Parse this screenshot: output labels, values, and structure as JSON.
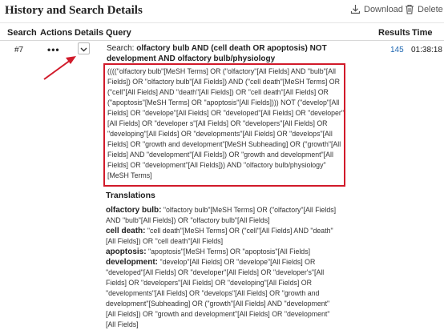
{
  "header": {
    "title": "History and Search Details",
    "download_label": "Download",
    "delete_label": "Delete"
  },
  "table": {
    "columns": [
      "Search",
      "Actions",
      "Details",
      "Query",
      "Results",
      "Time"
    ],
    "row": {
      "search_num": "#7",
      "actions_icon": "ellipsis-icon",
      "details_icon": "chevron-down-icon",
      "query_prefix": "Search:",
      "query_bold": "olfactory bulb AND (cell death OR apoptosis) NOT development AND olfactory bulb/physiology",
      "query_expanded": "((((\"olfactory bulb\"[MeSH Terms] OR (\"olfactory\"[All Fields] AND \"bulb\"[All Fields]) OR \"olfactory bulb\"[All Fields]) AND (\"cell death\"[MeSH Terms] OR (\"cell\"[All Fields] AND \"death\"[All Fields]) OR \"cell death\"[All Fields] OR (\"apoptosis\"[MeSH Terms] OR \"apoptosis\"[All Fields]))) NOT (\"develop\"[All Fields] OR \"develope\"[All Fields] OR \"developed\"[All Fields] OR \"developer\"[All Fields] OR \"developer s\"[All Fields] OR \"developers\"[All Fields] OR \"developing\"[All Fields] OR \"developments\"[All Fields] OR \"develops\"[All Fields] OR \"growth and development\"[MeSH Subheading] OR (\"growth\"[All Fields] AND \"development\"[All Fields]) OR \"growth and development\"[All Fields] OR \"development\"[All Fields])) AND \"olfactory bulb/physiology\"[MeSH Terms]",
      "results": "145",
      "time": "01:38:18"
    }
  },
  "translations": {
    "title": "Translations",
    "items": [
      {
        "term": "olfactory bulb:",
        "text": "\"olfactory bulb\"[MeSH Terms] OR (\"olfactory\"[All Fields] AND \"bulb\"[All Fields]) OR \"olfactory bulb\"[All Fields]"
      },
      {
        "term": "cell death:",
        "text": "\"cell death\"[MeSH Terms] OR (\"cell\"[All Fields] AND \"death\"[All Fields]) OR \"cell death\"[All Fields]"
      },
      {
        "term": "apoptosis:",
        "text": "\"apoptosis\"[MeSH Terms] OR \"apoptosis\"[All Fields]"
      },
      {
        "term": "development:",
        "text": "\"develop\"[All Fields] OR \"develope\"[All Fields] OR \"developed\"[All Fields] OR \"developer\"[All Fields] OR \"developer's\"[All Fields] OR \"developers\"[All Fields] OR \"developing\"[All Fields] OR \"developments\"[All Fields] OR \"develops\"[All Fields] OR \"growth and development\"[Subheading] OR (\"growth\"[All Fields] AND \"development\"[All Fields]) OR \"growth and development\"[All Fields] OR \"development\"[All Fields]"
      }
    ]
  },
  "colors": {
    "highlight_border": "#d11a2a",
    "link": "#2169b3",
    "annotation_arrow": "#d11a2a"
  }
}
